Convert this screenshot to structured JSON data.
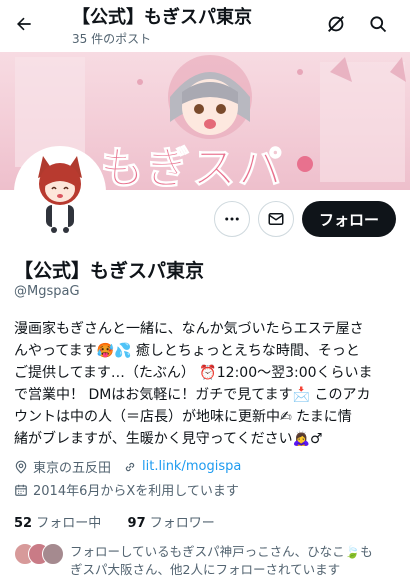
{
  "header": {
    "title": "【公式】もぎスパ東京",
    "post_count": "35 件のポスト"
  },
  "banner": {
    "logo_text": "もぎスパ"
  },
  "profile": {
    "name": "【公式】もぎスパ東京",
    "handle": "@MgspaG",
    "follow_label": "フォロー",
    "bio_lines": [
      "漫画家もぎさんと一緒に、なんか気づいたらエステ屋さ",
      "んやってます🥵💦 癒しとちょっとえちな時間、そっと",
      "ご提供してます…（たぶん） ⏰12:00〜翌3:00くらいま",
      "で営業中！ DMはお気軽に！ガチで見てます📩 このアカ",
      "ウントは中の人（＝店長）が地味に更新中✍ たまに情",
      "緒がブレますが、生暖かく見守ってください🙇‍♀️♂"
    ],
    "location": "東京の五反田",
    "website": "lit.link/mogispa",
    "joined": "2014年6月からXを利用しています"
  },
  "stats": {
    "following_count": "52",
    "following_label": "フォロー中",
    "followers_count": "97",
    "followers_label": "フォロワー"
  },
  "followers_you_know": {
    "text": "フォローしているもぎスパ神戸っこさん、ひなこ🍃も",
    "text2": "ぎスパ大阪さん、他2人にフォローされています"
  },
  "colors": {
    "accent": "#1d9bf0",
    "banner_pink": "#f3cdd7",
    "logo_pink": "#e8718e",
    "follow_bg": "#0f1419"
  }
}
